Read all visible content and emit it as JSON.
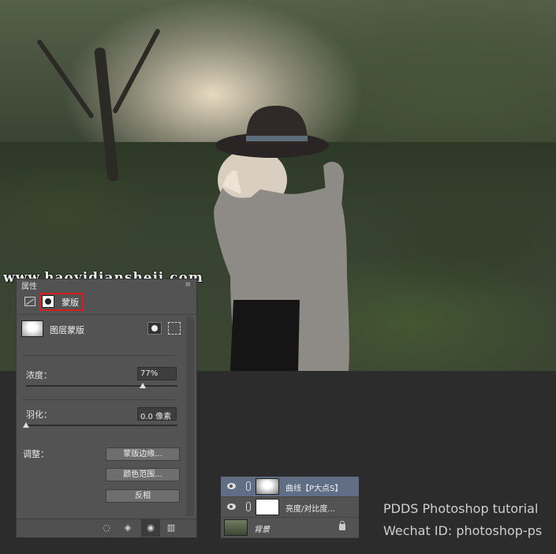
{
  "watermark": "www.haoyidiansheji.com",
  "properties_panel": {
    "tab_label": "属性",
    "menu_glyph": "≡",
    "mask_tab_label": "蒙版",
    "mask_name": "图层蒙版",
    "density_label": "浓度：",
    "density_value": "77%",
    "density_fraction": 0.77,
    "feather_label": "羽化：",
    "feather_value": "0.0 像素",
    "feather_fraction": 0.0,
    "refine_label": "调整：",
    "buttons": [
      "蒙版边缘...",
      "颜色范围...",
      "反相"
    ],
    "footer_icons": [
      "selection-icon",
      "apply-mask-icon",
      "visibility-icon",
      "trash-icon"
    ]
  },
  "layers_panel": {
    "layers": [
      {
        "name": "曲线【P大点S】",
        "selected": true
      },
      {
        "name": "亮度/对比度...",
        "selected": false
      },
      {
        "name": "背景",
        "selected": false
      }
    ]
  },
  "credits": {
    "line1": "PDDS Photoshop tutorial",
    "line2": "Wechat ID: photoshop-ps"
  }
}
